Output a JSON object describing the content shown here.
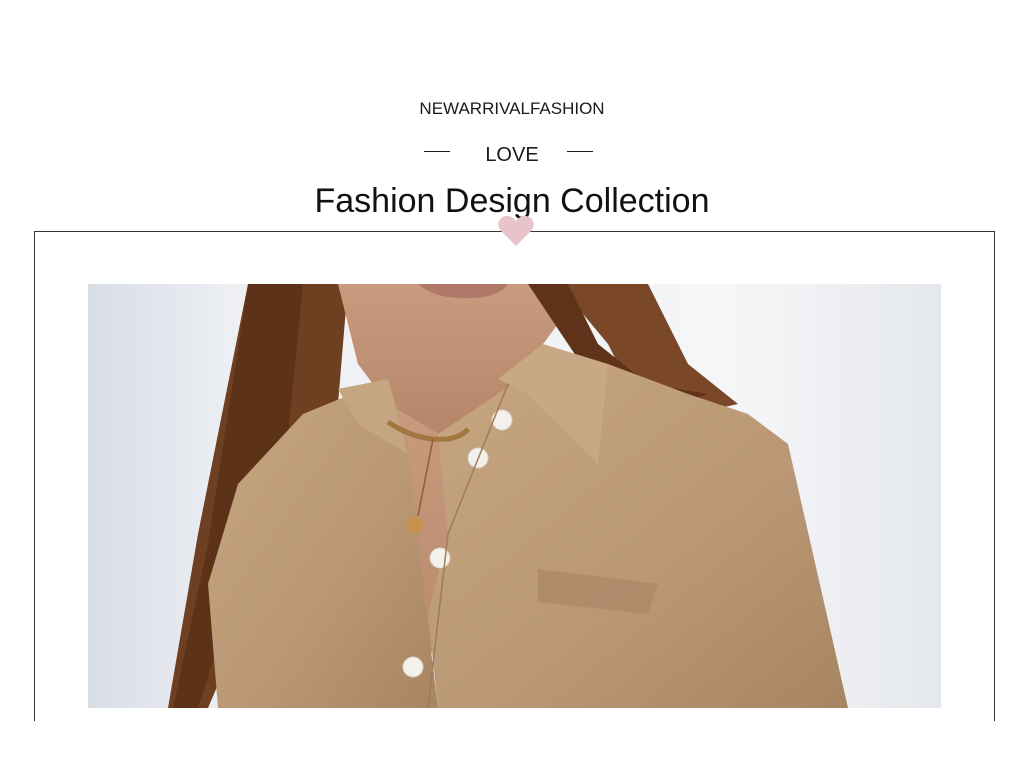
{
  "header": {
    "kicker": "NEWARRIVALFASHION",
    "love": "LOVE",
    "title": "Fashion Design Collection"
  },
  "icons": {
    "heart": "heart-icon"
  },
  "colors": {
    "heart": "#e9c3cc",
    "shirt": "#b99774",
    "hair": "#6f3f22",
    "background": "#eceef2",
    "frame": "#333333"
  },
  "photo": {
    "subject": "model-in-tan-shirt"
  }
}
